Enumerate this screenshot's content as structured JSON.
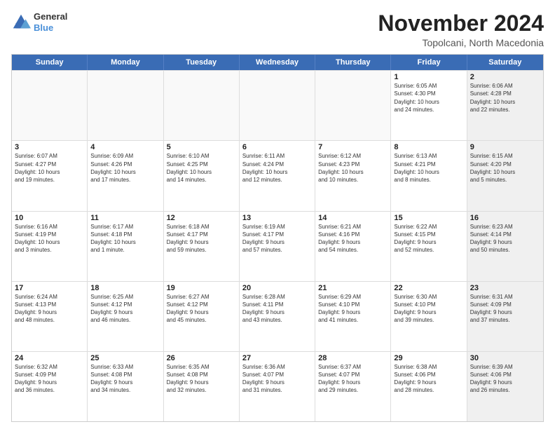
{
  "logo": {
    "line1": "General",
    "line2": "Blue"
  },
  "header": {
    "month": "November 2024",
    "location": "Topolcani, North Macedonia"
  },
  "weekdays": [
    "Sunday",
    "Monday",
    "Tuesday",
    "Wednesday",
    "Thursday",
    "Friday",
    "Saturday"
  ],
  "rows": [
    [
      {
        "day": "",
        "text": "",
        "empty": true
      },
      {
        "day": "",
        "text": "",
        "empty": true
      },
      {
        "day": "",
        "text": "",
        "empty": true
      },
      {
        "day": "",
        "text": "",
        "empty": true
      },
      {
        "day": "",
        "text": "",
        "empty": true
      },
      {
        "day": "1",
        "text": "Sunrise: 6:05 AM\nSunset: 4:30 PM\nDaylight: 10 hours\nand 24 minutes.",
        "empty": false
      },
      {
        "day": "2",
        "text": "Sunrise: 6:06 AM\nSunset: 4:28 PM\nDaylight: 10 hours\nand 22 minutes.",
        "empty": false,
        "shaded": true
      }
    ],
    [
      {
        "day": "3",
        "text": "Sunrise: 6:07 AM\nSunset: 4:27 PM\nDaylight: 10 hours\nand 19 minutes.",
        "empty": false
      },
      {
        "day": "4",
        "text": "Sunrise: 6:09 AM\nSunset: 4:26 PM\nDaylight: 10 hours\nand 17 minutes.",
        "empty": false
      },
      {
        "day": "5",
        "text": "Sunrise: 6:10 AM\nSunset: 4:25 PM\nDaylight: 10 hours\nand 14 minutes.",
        "empty": false
      },
      {
        "day": "6",
        "text": "Sunrise: 6:11 AM\nSunset: 4:24 PM\nDaylight: 10 hours\nand 12 minutes.",
        "empty": false
      },
      {
        "day": "7",
        "text": "Sunrise: 6:12 AM\nSunset: 4:23 PM\nDaylight: 10 hours\nand 10 minutes.",
        "empty": false
      },
      {
        "day": "8",
        "text": "Sunrise: 6:13 AM\nSunset: 4:21 PM\nDaylight: 10 hours\nand 8 minutes.",
        "empty": false
      },
      {
        "day": "9",
        "text": "Sunrise: 6:15 AM\nSunset: 4:20 PM\nDaylight: 10 hours\nand 5 minutes.",
        "empty": false,
        "shaded": true
      }
    ],
    [
      {
        "day": "10",
        "text": "Sunrise: 6:16 AM\nSunset: 4:19 PM\nDaylight: 10 hours\nand 3 minutes.",
        "empty": false
      },
      {
        "day": "11",
        "text": "Sunrise: 6:17 AM\nSunset: 4:18 PM\nDaylight: 10 hours\nand 1 minute.",
        "empty": false
      },
      {
        "day": "12",
        "text": "Sunrise: 6:18 AM\nSunset: 4:17 PM\nDaylight: 9 hours\nand 59 minutes.",
        "empty": false
      },
      {
        "day": "13",
        "text": "Sunrise: 6:19 AM\nSunset: 4:17 PM\nDaylight: 9 hours\nand 57 minutes.",
        "empty": false
      },
      {
        "day": "14",
        "text": "Sunrise: 6:21 AM\nSunset: 4:16 PM\nDaylight: 9 hours\nand 54 minutes.",
        "empty": false
      },
      {
        "day": "15",
        "text": "Sunrise: 6:22 AM\nSunset: 4:15 PM\nDaylight: 9 hours\nand 52 minutes.",
        "empty": false
      },
      {
        "day": "16",
        "text": "Sunrise: 6:23 AM\nSunset: 4:14 PM\nDaylight: 9 hours\nand 50 minutes.",
        "empty": false,
        "shaded": true
      }
    ],
    [
      {
        "day": "17",
        "text": "Sunrise: 6:24 AM\nSunset: 4:13 PM\nDaylight: 9 hours\nand 48 minutes.",
        "empty": false
      },
      {
        "day": "18",
        "text": "Sunrise: 6:25 AM\nSunset: 4:12 PM\nDaylight: 9 hours\nand 46 minutes.",
        "empty": false
      },
      {
        "day": "19",
        "text": "Sunrise: 6:27 AM\nSunset: 4:12 PM\nDaylight: 9 hours\nand 45 minutes.",
        "empty": false
      },
      {
        "day": "20",
        "text": "Sunrise: 6:28 AM\nSunset: 4:11 PM\nDaylight: 9 hours\nand 43 minutes.",
        "empty": false
      },
      {
        "day": "21",
        "text": "Sunrise: 6:29 AM\nSunset: 4:10 PM\nDaylight: 9 hours\nand 41 minutes.",
        "empty": false
      },
      {
        "day": "22",
        "text": "Sunrise: 6:30 AM\nSunset: 4:10 PM\nDaylight: 9 hours\nand 39 minutes.",
        "empty": false
      },
      {
        "day": "23",
        "text": "Sunrise: 6:31 AM\nSunset: 4:09 PM\nDaylight: 9 hours\nand 37 minutes.",
        "empty": false,
        "shaded": true
      }
    ],
    [
      {
        "day": "24",
        "text": "Sunrise: 6:32 AM\nSunset: 4:09 PM\nDaylight: 9 hours\nand 36 minutes.",
        "empty": false
      },
      {
        "day": "25",
        "text": "Sunrise: 6:33 AM\nSunset: 4:08 PM\nDaylight: 9 hours\nand 34 minutes.",
        "empty": false
      },
      {
        "day": "26",
        "text": "Sunrise: 6:35 AM\nSunset: 4:08 PM\nDaylight: 9 hours\nand 32 minutes.",
        "empty": false
      },
      {
        "day": "27",
        "text": "Sunrise: 6:36 AM\nSunset: 4:07 PM\nDaylight: 9 hours\nand 31 minutes.",
        "empty": false
      },
      {
        "day": "28",
        "text": "Sunrise: 6:37 AM\nSunset: 4:07 PM\nDaylight: 9 hours\nand 29 minutes.",
        "empty": false
      },
      {
        "day": "29",
        "text": "Sunrise: 6:38 AM\nSunset: 4:06 PM\nDaylight: 9 hours\nand 28 minutes.",
        "empty": false
      },
      {
        "day": "30",
        "text": "Sunrise: 6:39 AM\nSunset: 4:06 PM\nDaylight: 9 hours\nand 26 minutes.",
        "empty": false,
        "shaded": true
      }
    ]
  ]
}
